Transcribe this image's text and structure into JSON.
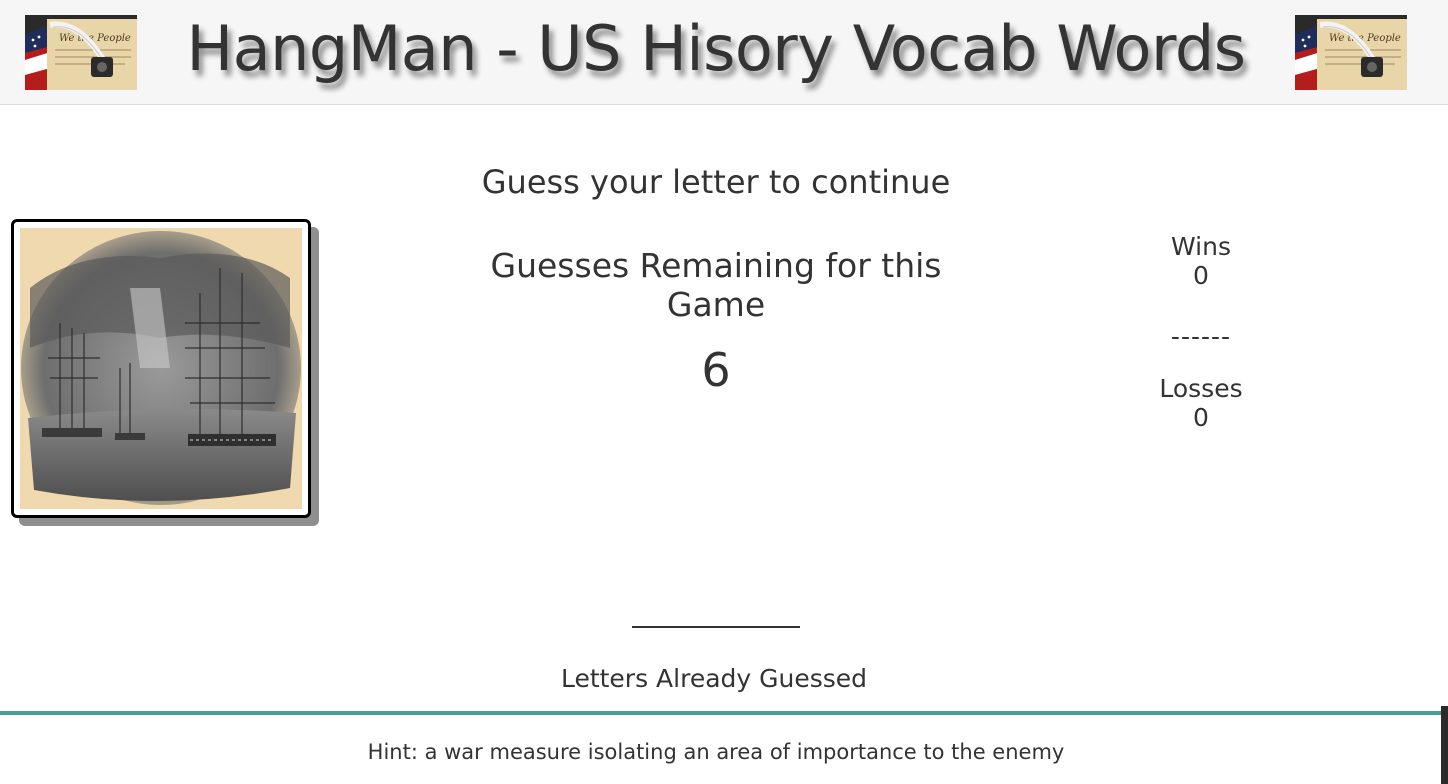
{
  "header": {
    "title": "HangMan - US Hisory Vocab Words",
    "left_image_icon": "constitution-quill-flag-image",
    "right_image_icon": "constitution-quill-flag-image"
  },
  "game": {
    "prompt": "Guess your letter to continue",
    "guesses_label": "Guesses Remaining for this Game",
    "guesses_remaining": "6",
    "word_display": "",
    "letters_guessed_label": "Letters Already Guessed",
    "letters_guessed": ""
  },
  "score": {
    "wins_label": "Wins",
    "wins": "0",
    "separator": "------",
    "losses_label": "Losses",
    "losses": "0"
  },
  "hint": {
    "text": "Hint: a war measure isolating an area of importance to the enemy"
  },
  "colors": {
    "header_bg": "#f6f6f6",
    "footer_accent": "#4a9d9c",
    "text": "#333333"
  }
}
